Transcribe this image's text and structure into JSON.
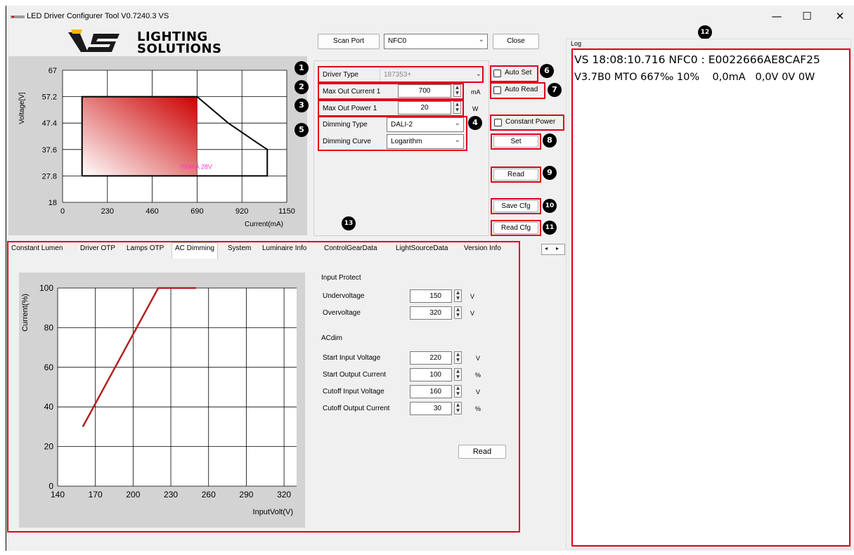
{
  "window": {
    "title": "LED Driver Configurer Tool V0.7240.3  VS",
    "minimize": "—",
    "maximize": "☐",
    "close": "✕"
  },
  "logo": {
    "line1": "LIGHTING",
    "line2": "SOLUTIONS"
  },
  "toolbar": {
    "scan_port": "Scan Port",
    "port_value": "NFC0",
    "close": "Close"
  },
  "settings": {
    "driver_type_label": "Driver Type",
    "driver_type_value": "187353+",
    "max_out_current_label": "Max Out Current 1",
    "max_out_current_value": "700",
    "max_out_current_unit": "mA",
    "max_out_power_label": "Max Out Power 1",
    "max_out_power_value": "20",
    "max_out_power_unit": "W",
    "dimming_type_label": "Dimming Type",
    "dimming_type_value": "DALI-2",
    "dimming_curve_label": "Dimming Curve",
    "dimming_curve_value": "Logarithm"
  },
  "options": {
    "auto_set": "Auto Set",
    "auto_read": "Auto Read",
    "constant_power": "Constant Power"
  },
  "actions": {
    "set": "Set",
    "read": "Read",
    "save_cfg": "Save Cfg",
    "read_cfg": "Read Cfg"
  },
  "badges": [
    "1",
    "2",
    "3",
    "4",
    "5",
    "6",
    "7",
    "8",
    "9",
    "10",
    "11",
    "12",
    "13"
  ],
  "log": {
    "title": "Log",
    "line1": "VS 18:08:10.716 NFC0 : E0022666AE8CAF25",
    "line2": "V3.7B0 MTO 667‰ 10%    0,0mA   0,0V 0V 0W"
  },
  "tabs": [
    "Constant Lumen",
    "Driver OTP",
    "Lamps OTP",
    "AC Dimming",
    "System",
    "Luminaire Info",
    "ControlGearData",
    "LightSourceData",
    "Version Info"
  ],
  "active_tab": "AC Dimming",
  "tab_scroll": {
    "left": "◂",
    "right": "▸"
  },
  "ac_dimming": {
    "input_protect_title": "Input Protect",
    "undervoltage_label": "Undervoltage",
    "undervoltage_value": "150",
    "undervoltage_unit": "V",
    "overvoltage_label": "Overvoltage",
    "overvoltage_value": "320",
    "overvoltage_unit": "V",
    "acdim_title": "ACdim",
    "start_input_voltage_label": "Start Input Voltage",
    "start_input_voltage_value": "220",
    "start_input_voltage_unit": "V",
    "start_output_current_label": "Start Output Current",
    "start_output_current_value": "100",
    "start_output_current_unit": "%",
    "cutoff_input_voltage_label": "Cutoff Input Voltage",
    "cutoff_input_voltage_value": "160",
    "cutoff_input_voltage_unit": "V",
    "cutoff_output_current_label": "Cutoff Output Current",
    "cutoff_output_current_value": "30",
    "cutoff_output_current_unit": "%",
    "read": "Read"
  },
  "colors": {
    "highlight": "#e0001a",
    "curve": "#b22222",
    "operating_area": "#cc0000",
    "annotation": "#ff33cc"
  },
  "chart_data": [
    {
      "type": "area",
      "xlabel": "Current(mA)",
      "ylabel": "Voltage[V]",
      "xticks": [
        0,
        230,
        460,
        690,
        920,
        1150
      ],
      "yticks": [
        18,
        27.8,
        37.6,
        47.4,
        57.2,
        67
      ],
      "xlim": [
        0,
        1150
      ],
      "ylim": [
        18,
        67
      ],
      "grid": true,
      "envelope": {
        "x": [
          100,
          100,
          690,
          850,
          1000,
          1050,
          1050,
          100
        ],
        "y": [
          27.8,
          57.2,
          57.2,
          47.4,
          40,
          37.6,
          27.8,
          27.8
        ]
      },
      "operating_area": {
        "x": [
          100,
          690
        ],
        "y": [
          27.8,
          57.2
        ]
      },
      "annotation": "700mA 28V"
    },
    {
      "type": "line",
      "xlabel": "InputVolt(V)",
      "ylabel": "Current(%)",
      "xticks": [
        140,
        170,
        200,
        230,
        260,
        290,
        320
      ],
      "yticks": [
        0,
        20,
        40,
        60,
        80,
        100
      ],
      "xlim": [
        140,
        330
      ],
      "ylim": [
        0,
        100
      ],
      "grid": true,
      "series": [
        {
          "x": [
            160,
            220,
            250
          ],
          "y": [
            30,
            100,
            100
          ]
        }
      ]
    }
  ]
}
